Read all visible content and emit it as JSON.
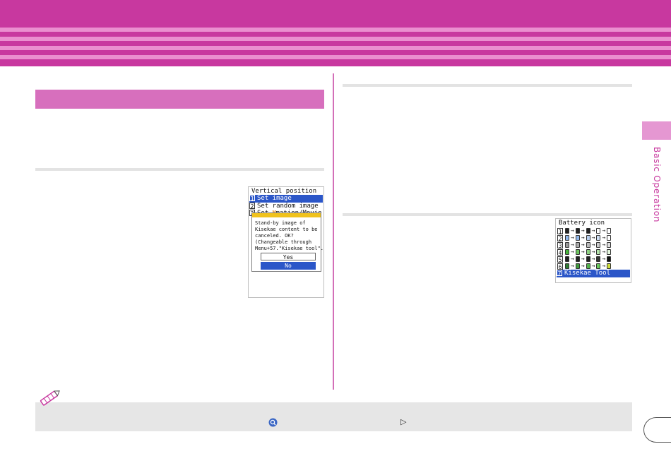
{
  "colors": {
    "banner": "#c8389f",
    "banner_stripe": "#ea8fcf",
    "section_bar": "#d76fbd",
    "side_tab": "#e597d2",
    "selection": "#2b56c8",
    "dialog_header": "#f0c21c",
    "note_background": "#e6e6e6"
  },
  "sidebar": {
    "label": "Basic Operation"
  },
  "screen1": {
    "title": "Vertical position",
    "items": [
      {
        "num": "1",
        "label": "Set image"
      },
      {
        "num": "2",
        "label": "Set random image"
      },
      {
        "num": "3",
        "label": "Set ",
        "icon": "m-icon",
        "label_after": "mation/Movie"
      }
    ],
    "dialog": {
      "message": "Stand-by image of\nKisekae content to be\ncanceled. OK?\n(Changeable through\nMenu+57.\"Kisekae tool\".)",
      "yes": "Yes",
      "no": "No"
    }
  },
  "screen2": {
    "title": "Battery icon",
    "rows": [
      "1",
      "2",
      "3",
      "4",
      "5",
      "6"
    ],
    "arrow": "→",
    "last_item": {
      "num": "7",
      "label": "Kisekae Tool"
    }
  },
  "icons": [
    "pencil-note-icon",
    "magnifier-icon",
    "triangle-right-icon"
  ]
}
